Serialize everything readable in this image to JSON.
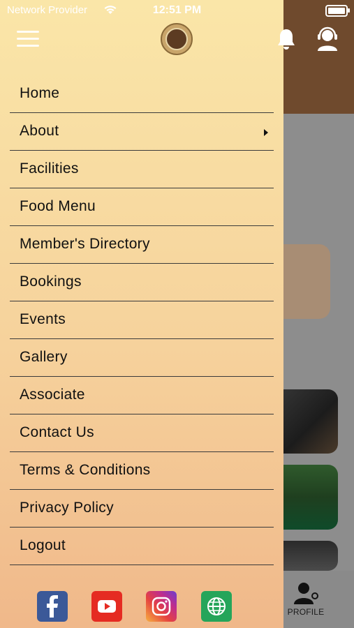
{
  "status_bar": {
    "carrier": "Network Provider",
    "time": "12:51 PM"
  },
  "drawer": {
    "menu": [
      {
        "label": "Home"
      },
      {
        "label": "About",
        "has_submenu": true
      },
      {
        "label": "Facilities"
      },
      {
        "label": "Food Menu"
      },
      {
        "label": "Member's Directory"
      },
      {
        "label": "Bookings"
      },
      {
        "label": "Events"
      },
      {
        "label": "Gallery"
      },
      {
        "label": "Associate"
      },
      {
        "label": "Contact Us"
      },
      {
        "label": "Terms & Conditions"
      },
      {
        "label": "Privacy Policy"
      },
      {
        "label": "Logout"
      }
    ],
    "social": [
      "facebook-icon",
      "youtube-icon",
      "instagram-icon",
      "globe-icon"
    ]
  },
  "bottom_nav": {
    "profile_label": "PROFILE"
  },
  "colors": {
    "drawer_top": "#fae6a8",
    "drawer_bottom": "#f0b88a",
    "header_brown": "#6f4a2d"
  }
}
